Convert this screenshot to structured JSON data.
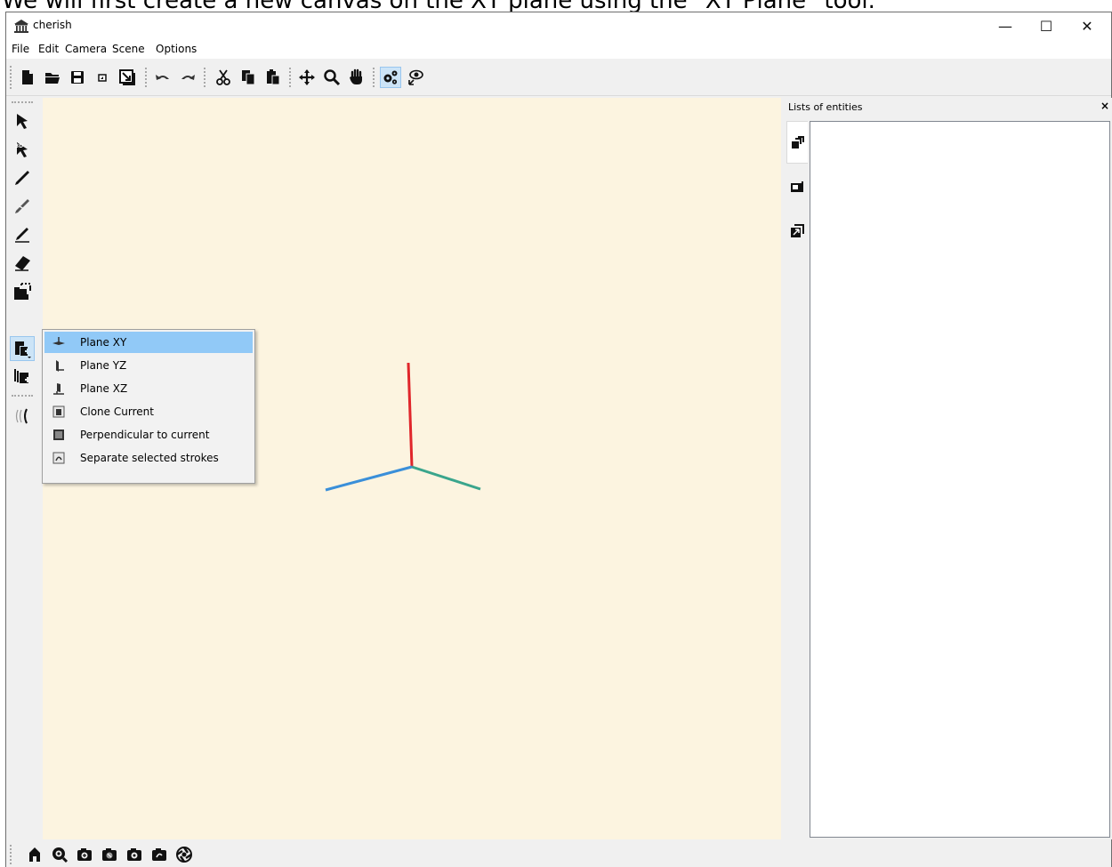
{
  "caption": "We will first create a new canvas on the XY plane using the \"XY Plane\" tool.",
  "window": {
    "title": "cherish",
    "minimize": "—",
    "maximize": "☐",
    "close": "✕"
  },
  "menubar": {
    "items": [
      "File",
      "Edit",
      "Camera",
      "Scene",
      "Options"
    ]
  },
  "toolbar": {
    "icons": [
      "new-file",
      "open-folder",
      "save",
      "save-image",
      "export-image",
      "undo",
      "redo",
      "cut",
      "copy",
      "paste",
      "move",
      "zoom",
      "pan",
      "settings",
      "visibility"
    ]
  },
  "left_tools": {
    "icons": [
      "select",
      "select-3d",
      "pen",
      "pen-disabled",
      "line",
      "eraser",
      "canvas-select",
      "new-canvas",
      "clone-canvas",
      "strokes"
    ]
  },
  "entities_panel": {
    "title": "Lists of entities",
    "close": "×"
  },
  "popup_menu": {
    "items": [
      {
        "label": "Plane XY",
        "icon": "plane-xy-icon"
      },
      {
        "label": "Plane YZ",
        "icon": "plane-yz-icon"
      },
      {
        "label": "Plane XZ",
        "icon": "plane-xz-icon"
      },
      {
        "label": "Clone Current",
        "icon": "clone-icon"
      },
      {
        "label": "Perpendicular to current",
        "icon": "perpendicular-icon"
      },
      {
        "label": "Separate selected strokes",
        "icon": "separate-icon"
      }
    ],
    "highlighted": "Plane XY"
  },
  "axes": {
    "colors": {
      "x": "#3a8fd9",
      "y": "#3aa58c",
      "z": "#e0262b"
    }
  },
  "bottom_bar": {
    "icons": [
      "home",
      "zoom-fit",
      "camera-front",
      "camera-side",
      "camera-top",
      "camera-rotate",
      "aperture"
    ]
  }
}
